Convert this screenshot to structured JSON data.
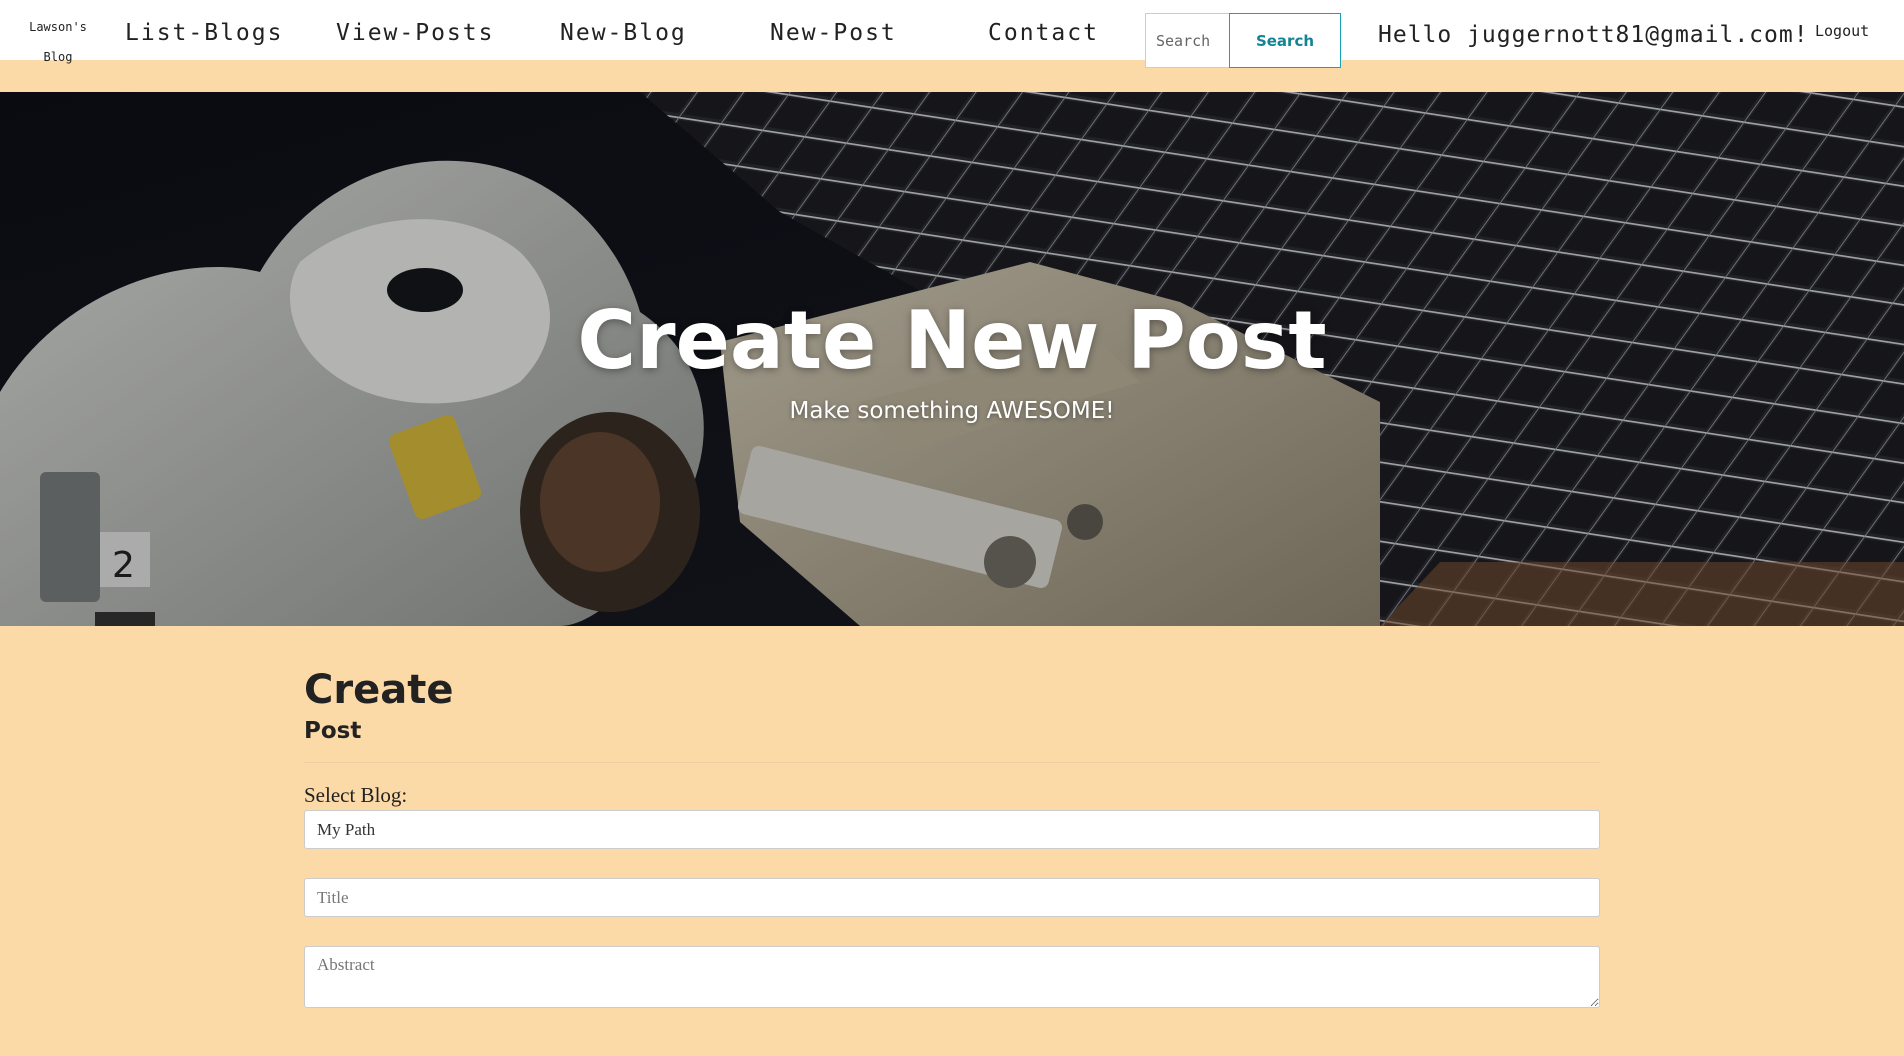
{
  "navbar": {
    "brand_line1": "Lawson's",
    "brand_line2": "Blog",
    "links": [
      {
        "label": "List-Blogs"
      },
      {
        "label": "View-Posts"
      },
      {
        "label": "New-Blog"
      },
      {
        "label": "New-Post"
      },
      {
        "label": "Contact"
      }
    ],
    "search_placeholder": "Search",
    "search_button": "Search",
    "greeting": "Hello juggernott81@gmail.com!",
    "logout": "Logout"
  },
  "hero": {
    "title": "Create New Post",
    "subtitle": "Make something AWESOME!"
  },
  "form": {
    "heading": "Create",
    "subheading": "Post",
    "select_label": "Select Blog:",
    "selected_blog": "My Path",
    "title_placeholder": "Title",
    "abstract_placeholder": "Abstract"
  },
  "colors": {
    "page_background": "#fcdaa8",
    "search_accent": "#17a2b8"
  }
}
